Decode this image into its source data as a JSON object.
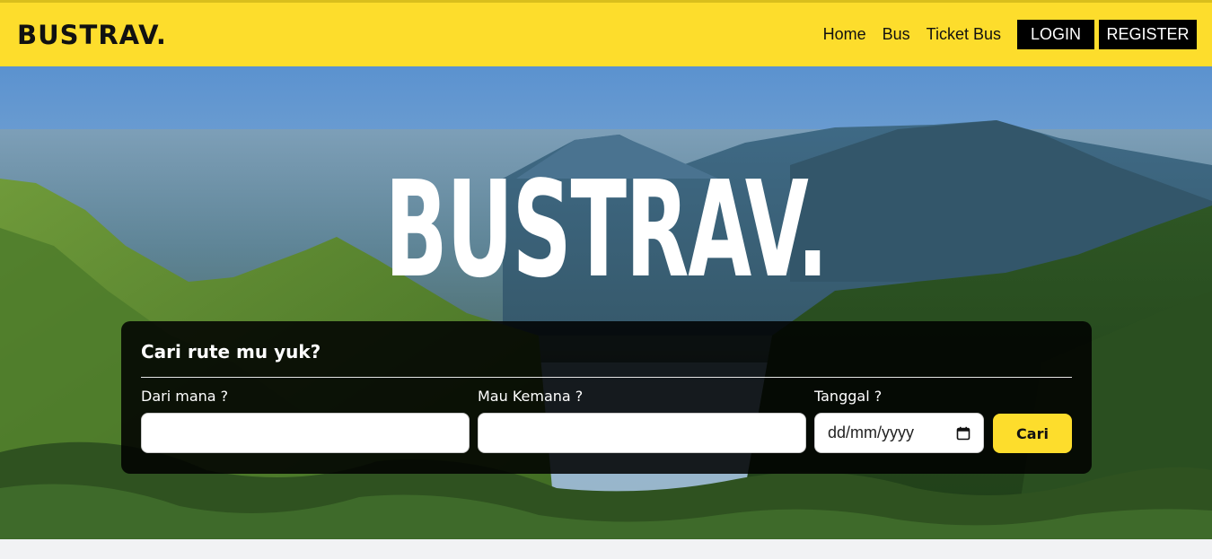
{
  "header": {
    "brand": "BUSTRAV.",
    "nav_links": [
      "Home",
      "Bus",
      "Ticket Bus"
    ],
    "login_label": "LOGIN",
    "register_label": "REGISTER"
  },
  "hero": {
    "title": "BUSTRAV."
  },
  "search": {
    "title": "Cari rute mu yuk?",
    "from_label": "Dari mana ?",
    "from_value": "",
    "to_label": "Mau Kemana ?",
    "to_value": "",
    "date_label": "Tanggal ?",
    "date_placeholder": "dd/mm/yyyy",
    "submit_label": "Cari"
  },
  "colors": {
    "brand_yellow": "#fddd2c",
    "nav_button_bg": "#000000",
    "panel_bg": "rgba(0,0,0,0.86)"
  },
  "icons": {
    "calendar": "calendar-icon"
  }
}
